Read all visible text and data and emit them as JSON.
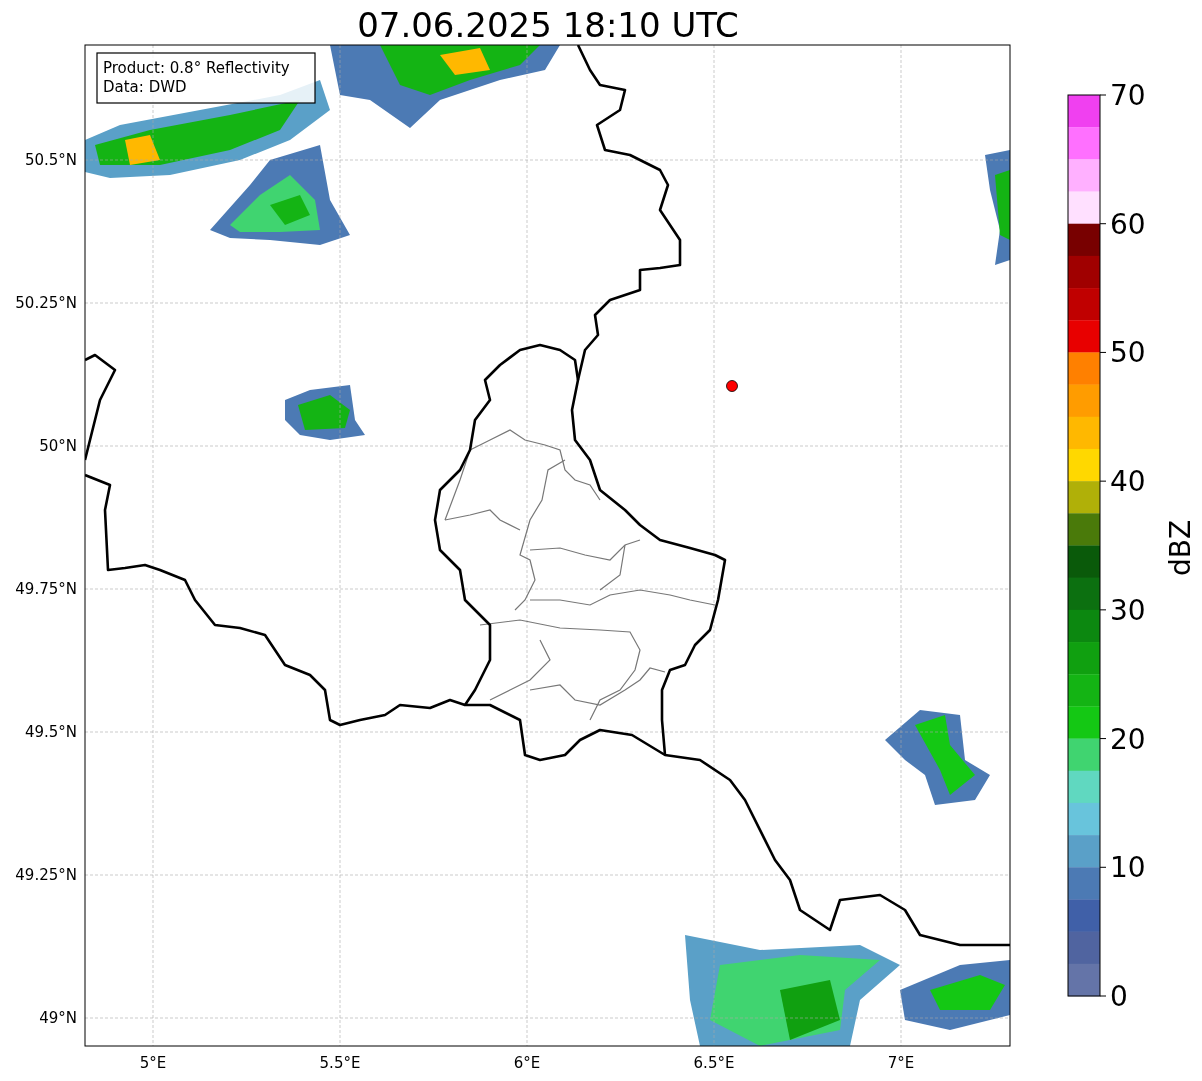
{
  "title": "07.06.2025 18:10 UTC",
  "info_box": {
    "lines": [
      "Product: 0.8° Reflectivity",
      "Data: DWD"
    ]
  },
  "map": {
    "lon_ticks": [
      "5°E",
      "5.5°E",
      "6°E",
      "6.5°E",
      "7°E"
    ],
    "lat_ticks": [
      "50.5°N",
      "50.25°N",
      "50°N",
      "49.75°N",
      "49.5°N",
      "49.25°N",
      "49°N"
    ]
  },
  "colorbar": {
    "label": "dBZ",
    "ticks": [
      "70",
      "60",
      "50",
      "40",
      "30",
      "20",
      "10",
      "0"
    ],
    "bands": [
      {
        "color": "#f040f0"
      },
      {
        "color": "#ff70ff"
      },
      {
        "color": "#ffb0ff"
      },
      {
        "color": "#ffe0ff"
      },
      {
        "color": "#780000"
      },
      {
        "color": "#a00000"
      },
      {
        "color": "#c00000"
      },
      {
        "color": "#e80000"
      },
      {
        "color": "#ff8000"
      },
      {
        "color": "#ff9c00"
      },
      {
        "color": "#ffb800"
      },
      {
        "color": "#ffd800"
      },
      {
        "color": "#b0b008"
      },
      {
        "color": "#4a7a0a"
      },
      {
        "color": "#0a5a0a"
      },
      {
        "color": "#0c7010"
      },
      {
        "color": "#0c8810"
      },
      {
        "color": "#10a010"
      },
      {
        "color": "#14b414"
      },
      {
        "color": "#14c814"
      },
      {
        "color": "#40d470"
      },
      {
        "color": "#60d8c0"
      },
      {
        "color": "#68c4dc"
      },
      {
        "color": "#5aa0c8"
      },
      {
        "color": "#4c7ab4"
      },
      {
        "color": "#4060a8"
      },
      {
        "color": "#5064a0"
      },
      {
        "color": "#6474a8"
      }
    ]
  }
}
